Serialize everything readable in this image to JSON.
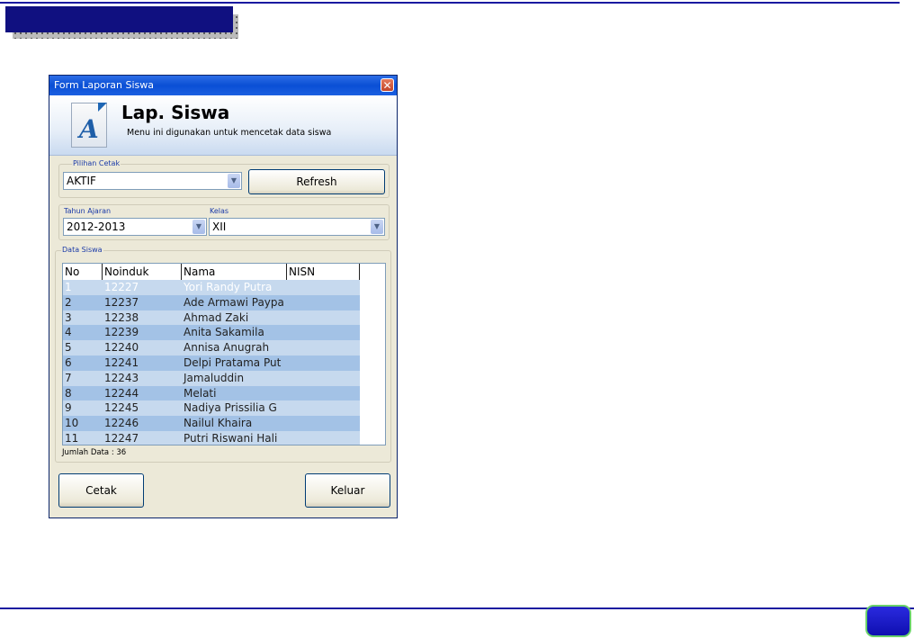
{
  "window": {
    "title": "Form Laporan Siswa",
    "close_glyph": "✕"
  },
  "header": {
    "icon_letter": "A",
    "title": "Lap. Siswa",
    "subtitle": "Menu ini digunakan untuk mencetak data siswa"
  },
  "pilihan": {
    "label": "Pilihan Cetak",
    "value": "AKTIF",
    "refresh_label": "Refresh"
  },
  "filter": {
    "tahun_label": "Tahun Ajaran",
    "tahun_value": "2012-2013",
    "kelas_label": "Kelas",
    "kelas_value": "XII"
  },
  "data_siswa": {
    "label": "Data Siswa",
    "columns": [
      "No",
      "Noinduk",
      "Nama",
      "NISN"
    ],
    "rows": [
      [
        "1",
        "12227",
        "Yori Randy Putra",
        ""
      ],
      [
        "2",
        "12237",
        "Ade Armawi Paypa",
        ""
      ],
      [
        "3",
        "12238",
        "Ahmad Zaki",
        ""
      ],
      [
        "4",
        "12239",
        "Anita Sakamila",
        ""
      ],
      [
        "5",
        "12240",
        "Annisa Anugrah",
        ""
      ],
      [
        "6",
        "12241",
        "Delpi Pratama Put",
        ""
      ],
      [
        "7",
        "12243",
        "Jamaluddin",
        ""
      ],
      [
        "8",
        "12244",
        "Melati",
        ""
      ],
      [
        "9",
        "12245",
        "Nadiya Prissilia G",
        ""
      ],
      [
        "10",
        "12246",
        "Nailul Khaira",
        ""
      ],
      [
        "11",
        "12247",
        "Putri Riswani Hali",
        ""
      ]
    ],
    "jumlah": "Jumlah Data : 36"
  },
  "buttons": {
    "cetak": "Cetak",
    "keluar": "Keluar"
  },
  "colors": {
    "slide_rule": "#1a1aa0",
    "row_odd": "#c6d9ee",
    "row_even": "#a3c2e6"
  }
}
